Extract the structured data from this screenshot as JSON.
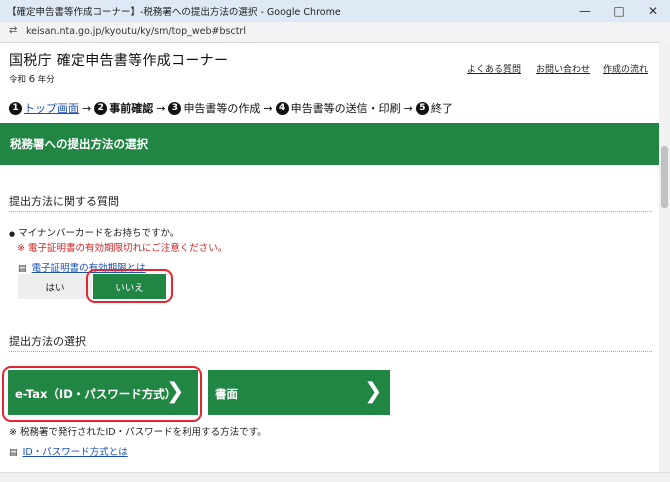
{
  "window": {
    "title": "【確定申告書等作成コーナー】-税務署への提出方法の選択 - Google Chrome",
    "url": "keisan.nta.go.jp/kyoutu/ky/sm/top_web#bsctrl"
  },
  "header": {
    "site_title": "国税庁 確定申告書等作成コーナー",
    "year_prefix": "令和",
    "year_number": "6",
    "year_suffix": "年分",
    "links": [
      "よくある質問",
      "お問い合わせ",
      "作成の流れ"
    ]
  },
  "steps": [
    {
      "num": "1",
      "label": "トップ画面",
      "state": "link"
    },
    {
      "num": "2",
      "label": "事前確認",
      "state": "current"
    },
    {
      "num": "3",
      "label": "申告書等の作成",
      "state": "normal"
    },
    {
      "num": "4",
      "label": "申告書等の送信・印刷",
      "state": "normal"
    },
    {
      "num": "5",
      "label": "終了",
      "state": "normal"
    }
  ],
  "banner": {
    "title": "税務署への提出方法の選択"
  },
  "question_section": {
    "heading": "提出方法に関する質問",
    "question": "マイナンバーカードをお持ちですか。",
    "warning": "※ 電子証明書の有効期限切れにご注意ください。",
    "help_link": "電子証明書の有効期限とは",
    "yes_label": "はい",
    "no_label": "いいえ",
    "selected": "いいえ"
  },
  "method_section": {
    "heading": "提出方法の選択",
    "etax_label": "e-Tax（ID・パスワード方式）",
    "paper_label": "書面",
    "note": "※ 税務署で発行されたID・パスワードを利用する方法です。",
    "help_link": "ID・パスワード方式とは"
  },
  "colors": {
    "accent_green": "#218543",
    "highlight_red": "#e3262f",
    "link_blue": "#1a4fb5",
    "warning_red": "#d21f1f"
  }
}
